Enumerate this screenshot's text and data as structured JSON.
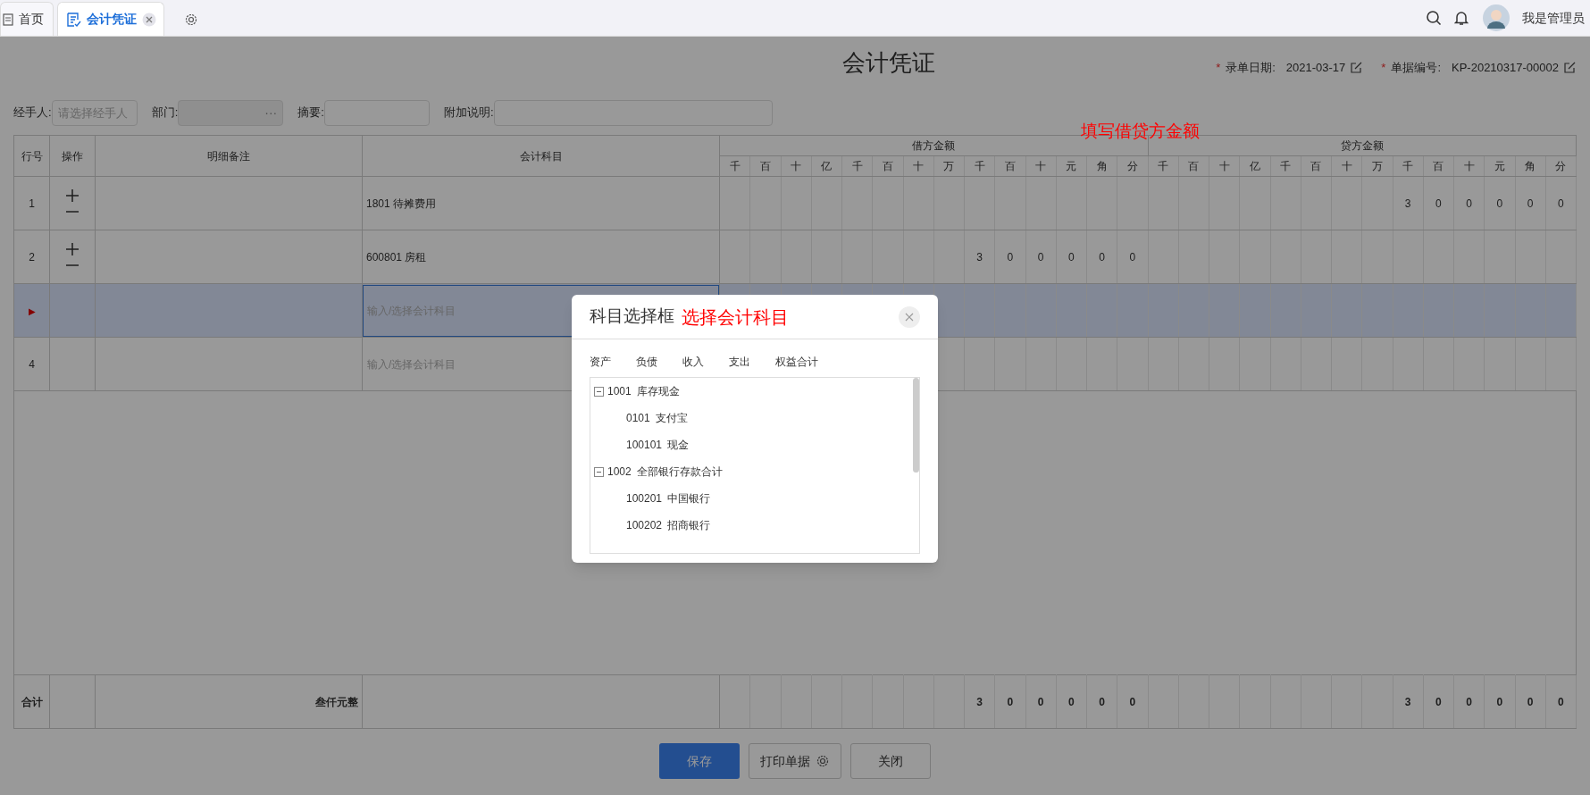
{
  "tabs": [
    {
      "label": "首页",
      "kind": "page",
      "selected": false
    },
    {
      "label": "会计凭证",
      "kind": "form",
      "selected": true
    }
  ],
  "user": {
    "name": "我是管理员"
  },
  "title": "会计凭证",
  "meta": [
    {
      "mark": "*",
      "label": "录单日期:",
      "value": "2021-03-17"
    },
    {
      "mark": "*",
      "label": "单据编号:",
      "value": "KP-20210317-00002"
    }
  ],
  "filters": [
    {
      "label": "经手人:",
      "kind": "text",
      "placeholder": "请选择经手人"
    },
    {
      "label": "部门:",
      "kind": "picker",
      "more": "···"
    },
    {
      "label": "摘要:",
      "kind": "text"
    },
    {
      "label": "附加说明:",
      "kind": "text"
    }
  ],
  "annotations": [
    {
      "text": "填写借贷方金额"
    }
  ],
  "table": {
    "columns": [
      "行号",
      "操作",
      "明细备注",
      "会计科目"
    ],
    "debit_title": "借方金额",
    "credit_title": "贷方金额",
    "debit_digits": [
      "千",
      "百",
      "十",
      "亿",
      "千",
      "百",
      "十",
      "万",
      "千",
      "百",
      "十",
      "元",
      "角",
      "分"
    ],
    "credit_digits": [
      "千",
      "百",
      "十",
      "亿",
      "千",
      "百",
      "十",
      "万",
      "千",
      "百",
      "十",
      "元",
      "角",
      "分"
    ],
    "rows": [
      {
        "number": "1",
        "selected": false,
        "operations": true,
        "subject": "1801 待摊费用",
        "credit": [
          "3",
          "0",
          "0",
          "0",
          "0",
          "0"
        ]
      },
      {
        "number": "2",
        "selected": false,
        "operations": true,
        "subject": "600801 房租",
        "debit": [
          "3",
          "0",
          "0",
          "0",
          "0",
          "0"
        ]
      },
      {
        "marker": "▶",
        "selected": true,
        "operations": false,
        "subject_placeholder": "输入/选择会计科目"
      },
      {
        "number": "4",
        "selected": false,
        "operations": false,
        "subject_placeholder": "输入/选择会计科目"
      }
    ],
    "total": {
      "label": "合计",
      "words": "叁仟元整",
      "debit": [
        "3",
        "0",
        "0",
        "0",
        "0",
        "0"
      ],
      "credit": [
        "3",
        "0",
        "0",
        "0",
        "0",
        "0"
      ]
    }
  },
  "buttons": [
    {
      "label": "保存",
      "kind": "primary"
    },
    {
      "label": "打印单据",
      "kind": "print"
    },
    {
      "label": "关闭",
      "kind": "plain"
    }
  ],
  "dialog": {
    "title": "科目选择框",
    "annotation": "选择会计科目",
    "tabs": [
      {
        "label": "资产",
        "selected": false
      },
      {
        "label": "负债",
        "selected": false
      },
      {
        "label": "收入",
        "selected": false
      },
      {
        "label": "支出",
        "selected": false
      },
      {
        "label": "权益合计",
        "selected": false
      }
    ],
    "tree": [
      {
        "code": "1001",
        "name": "库存现金",
        "expanded": true,
        "children": [
          {
            "code": "0101",
            "name": "支付宝"
          },
          {
            "code": "100101",
            "name": "现金"
          }
        ]
      },
      {
        "code": "1002",
        "name": "全部银行存款合计",
        "expanded": true,
        "children": [
          {
            "code": "100201",
            "name": "中国银行"
          },
          {
            "code": "100202",
            "name": "招商银行"
          }
        ]
      }
    ]
  }
}
